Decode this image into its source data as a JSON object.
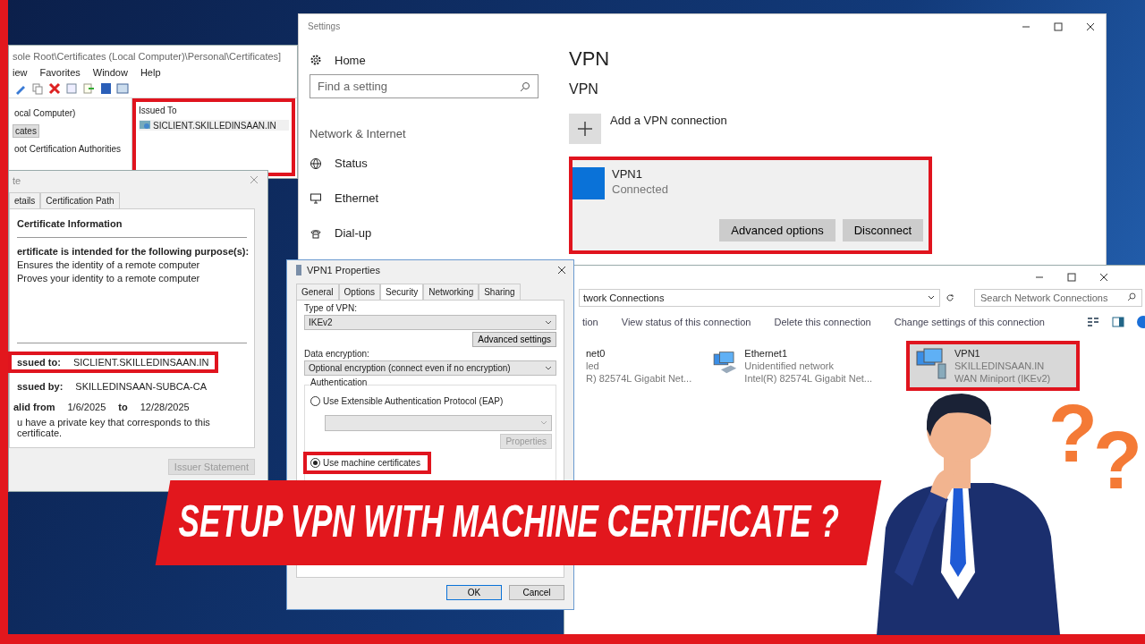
{
  "mmc": {
    "title": "sole Root\\Certificates (Local Computer)\\Personal\\Certificates]",
    "menu": [
      "iew",
      "Favorites",
      "Window",
      "Help"
    ],
    "tree": [
      {
        "label": "ocal Computer)",
        "selected": false
      },
      {
        "label": "cates",
        "selected": true
      },
      {
        "label": "oot Certification Authorities",
        "selected": false
      }
    ],
    "list": {
      "highlighted": true,
      "columns": [
        "Issued To"
      ],
      "rows": [
        "SICLIENT.SKILLEDINSAAN.IN"
      ]
    }
  },
  "certificate_dialog": {
    "title": "te",
    "tabs": [
      {
        "label": "etails",
        "selected": false
      },
      {
        "label": "Certification Path",
        "selected": false
      }
    ],
    "heading": "Certificate Information",
    "purpose_heading": "ertificate is intended for the following purpose(s):",
    "purposes": [
      "Ensures the identity of a remote computer",
      "Proves your identity to a remote computer"
    ],
    "issued_to": {
      "label": "ssued to:",
      "value": "SICLIENT.SKILLEDINSAAN.IN",
      "highlighted": true
    },
    "issued_by": {
      "label": "ssued by:",
      "value": "SKILLEDINSAAN-SUBCA-CA"
    },
    "valid": {
      "label": "alid from",
      "from": "1/6/2025",
      "to_label": "to",
      "to": "12/28/2025"
    },
    "note": "u have a private key that corresponds to this certificate.",
    "button": "Issuer Statement"
  },
  "settings": {
    "title": "Settings",
    "home": "Home",
    "search": {
      "placeholder": "Find a setting"
    },
    "section": "Network & Internet",
    "nav": [
      {
        "label": "Status",
        "kind": "globe"
      },
      {
        "label": "Ethernet",
        "kind": "monitor"
      },
      {
        "label": "Dial-up",
        "kind": "phone"
      }
    ],
    "heading": "VPN",
    "subheading": "VPN",
    "add_label": "Add a VPN connection",
    "connections": [
      {
        "name": "VPN1",
        "status": "Connected",
        "selected": true,
        "highlighted": true,
        "buttons": [
          "Advanced options",
          "Disconnect"
        ]
      }
    ]
  },
  "network_connections": {
    "address": "twork Connections",
    "search": {
      "placeholder": "Search Network Connections"
    },
    "commands": [
      "tion",
      "View status of this connection",
      "Delete this connection",
      "Change settings of this connection"
    ],
    "items": [
      {
        "kind": "cut",
        "lines": [
          "net0",
          "led",
          "R) 82574L Gigabit Net..."
        ],
        "selected": false,
        "highlighted": false
      },
      {
        "kind": "ethernet",
        "lines": [
          "Ethernet1",
          "Unidentified network",
          "Intel(R) 82574L Gigabit Net..."
        ],
        "selected": false,
        "highlighted": false
      },
      {
        "kind": "vpn",
        "lines": [
          "VPN1",
          "SKILLEDINSAAN.IN",
          "WAN Miniport (IKEv2)"
        ],
        "selected": true,
        "highlighted": true
      }
    ]
  },
  "vpn_properties": {
    "title": "VPN1 Properties",
    "tabs": [
      {
        "label": "General",
        "selected": false
      },
      {
        "label": "Options",
        "selected": false
      },
      {
        "label": "Security",
        "selected": true
      },
      {
        "label": "Networking",
        "selected": false
      },
      {
        "label": "Sharing",
        "selected": false
      }
    ],
    "type_label": "Type of VPN:",
    "type_value": "IKEv2",
    "advanced_button": "Advanced settings",
    "encryption_label": "Data encryption:",
    "encryption_value": "Optional encryption (connect even if no encryption)",
    "auth_label": "Authentication",
    "options": [
      {
        "label": "Use Extensible Authentication Protocol (EAP)",
        "selected": false,
        "highlighted": false
      },
      {
        "label": "Use machine certificates",
        "selected": true,
        "highlighted": true
      }
    ],
    "eap_button": "Properties",
    "buttons": [
      "OK",
      "Cancel"
    ]
  },
  "banner": {
    "text": "SETUP VPN WITH MACHINE CERTIFICATE ?"
  },
  "mascot": {
    "question_marks": [
      "?",
      "?"
    ]
  }
}
